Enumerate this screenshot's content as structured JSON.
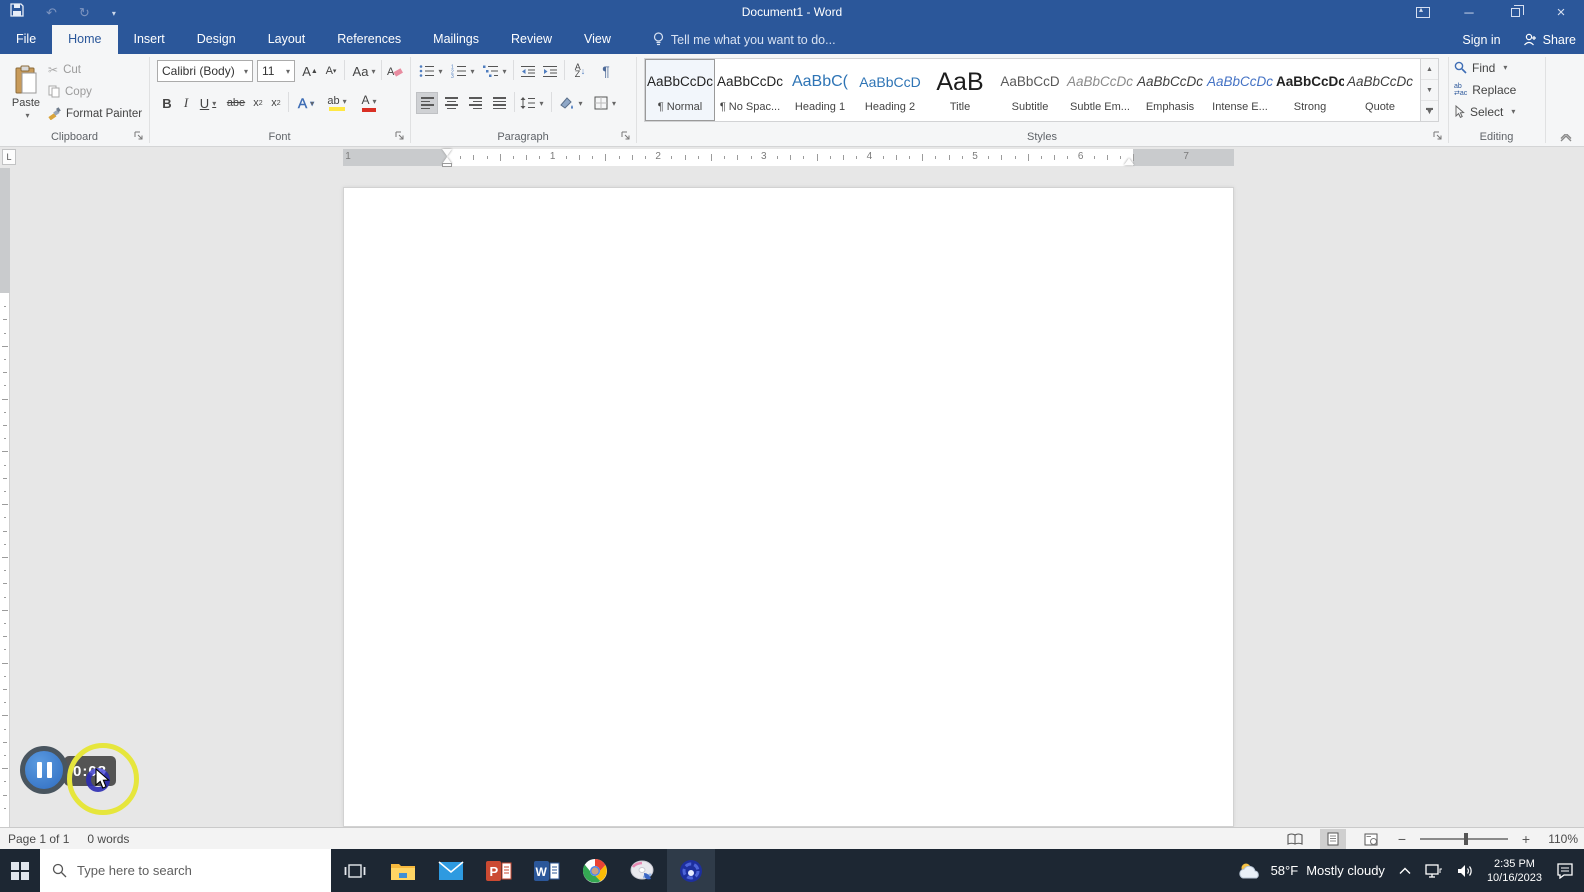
{
  "colors": {
    "word_blue": "#2b579a",
    "heading_blue": "#2e74b5",
    "taskbar_bg": "#1d2733",
    "click_ring_yellow": "#e6e63c"
  },
  "titlebar": {
    "title": "Document1 - Word"
  },
  "tabs": {
    "selected": "Home",
    "items": [
      "File",
      "Home",
      "Insert",
      "Design",
      "Layout",
      "References",
      "Mailings",
      "Review",
      "View"
    ]
  },
  "tellme": {
    "label": "Tell me what you want to do..."
  },
  "account": {
    "sign_in": "Sign in",
    "share": "Share"
  },
  "ribbon": {
    "clipboard": {
      "label": "Clipboard",
      "paste": "Paste",
      "cut": "Cut",
      "copy": "Copy",
      "format_painter": "Format Painter"
    },
    "font": {
      "label": "Font",
      "font_name": "Calibri (Body)",
      "font_size": "11"
    },
    "paragraph": {
      "label": "Paragraph"
    },
    "styles": {
      "label": "Styles",
      "items": [
        {
          "preview": "AaBbCcDc",
          "label": "¶ Normal",
          "kind": "normal",
          "selected": true
        },
        {
          "preview": "AaBbCcDc",
          "label": "¶ No Spac...",
          "kind": "normal",
          "selected": false
        },
        {
          "preview": "AaBbC(",
          "label": "Heading 1",
          "kind": "h1",
          "selected": false
        },
        {
          "preview": "AaBbCcD",
          "label": "Heading 2",
          "kind": "h2",
          "selected": false
        },
        {
          "preview": "AaB",
          "label": "Title",
          "kind": "title",
          "selected": false
        },
        {
          "preview": "AaBbCcD",
          "label": "Subtitle",
          "kind": "subtitle",
          "selected": false
        },
        {
          "preview": "AaBbCcDc",
          "label": "Subtle Em...",
          "kind": "subtle",
          "selected": false
        },
        {
          "preview": "AaBbCcDc",
          "label": "Emphasis",
          "kind": "emphasis",
          "selected": false
        },
        {
          "preview": "AaBbCcDc",
          "label": "Intense E...",
          "kind": "intense",
          "selected": false
        },
        {
          "preview": "AaBbCcDc",
          "label": "Strong",
          "kind": "strong",
          "selected": false
        },
        {
          "preview": "AaBbCcDc",
          "label": "Quote",
          "kind": "quote",
          "selected": false
        }
      ]
    },
    "editing": {
      "label": "Editing",
      "find": "Find",
      "replace": "Replace",
      "select": "Select"
    }
  },
  "ruler": {
    "left_margin_number": "1",
    "numbers": [
      "1",
      "2",
      "3",
      "4",
      "5",
      "6"
    ],
    "right_margin_number": "7"
  },
  "recorder": {
    "timer": "0:08"
  },
  "statusbar": {
    "page": "Page 1 of 1",
    "words": "0 words",
    "zoom_level": "110%"
  },
  "taskbar": {
    "search_placeholder": "Type here to search",
    "weather": {
      "temp": "58°F",
      "condition": "Mostly cloudy"
    },
    "clock": {
      "time": "2:35 PM",
      "date": "10/16/2023"
    }
  }
}
